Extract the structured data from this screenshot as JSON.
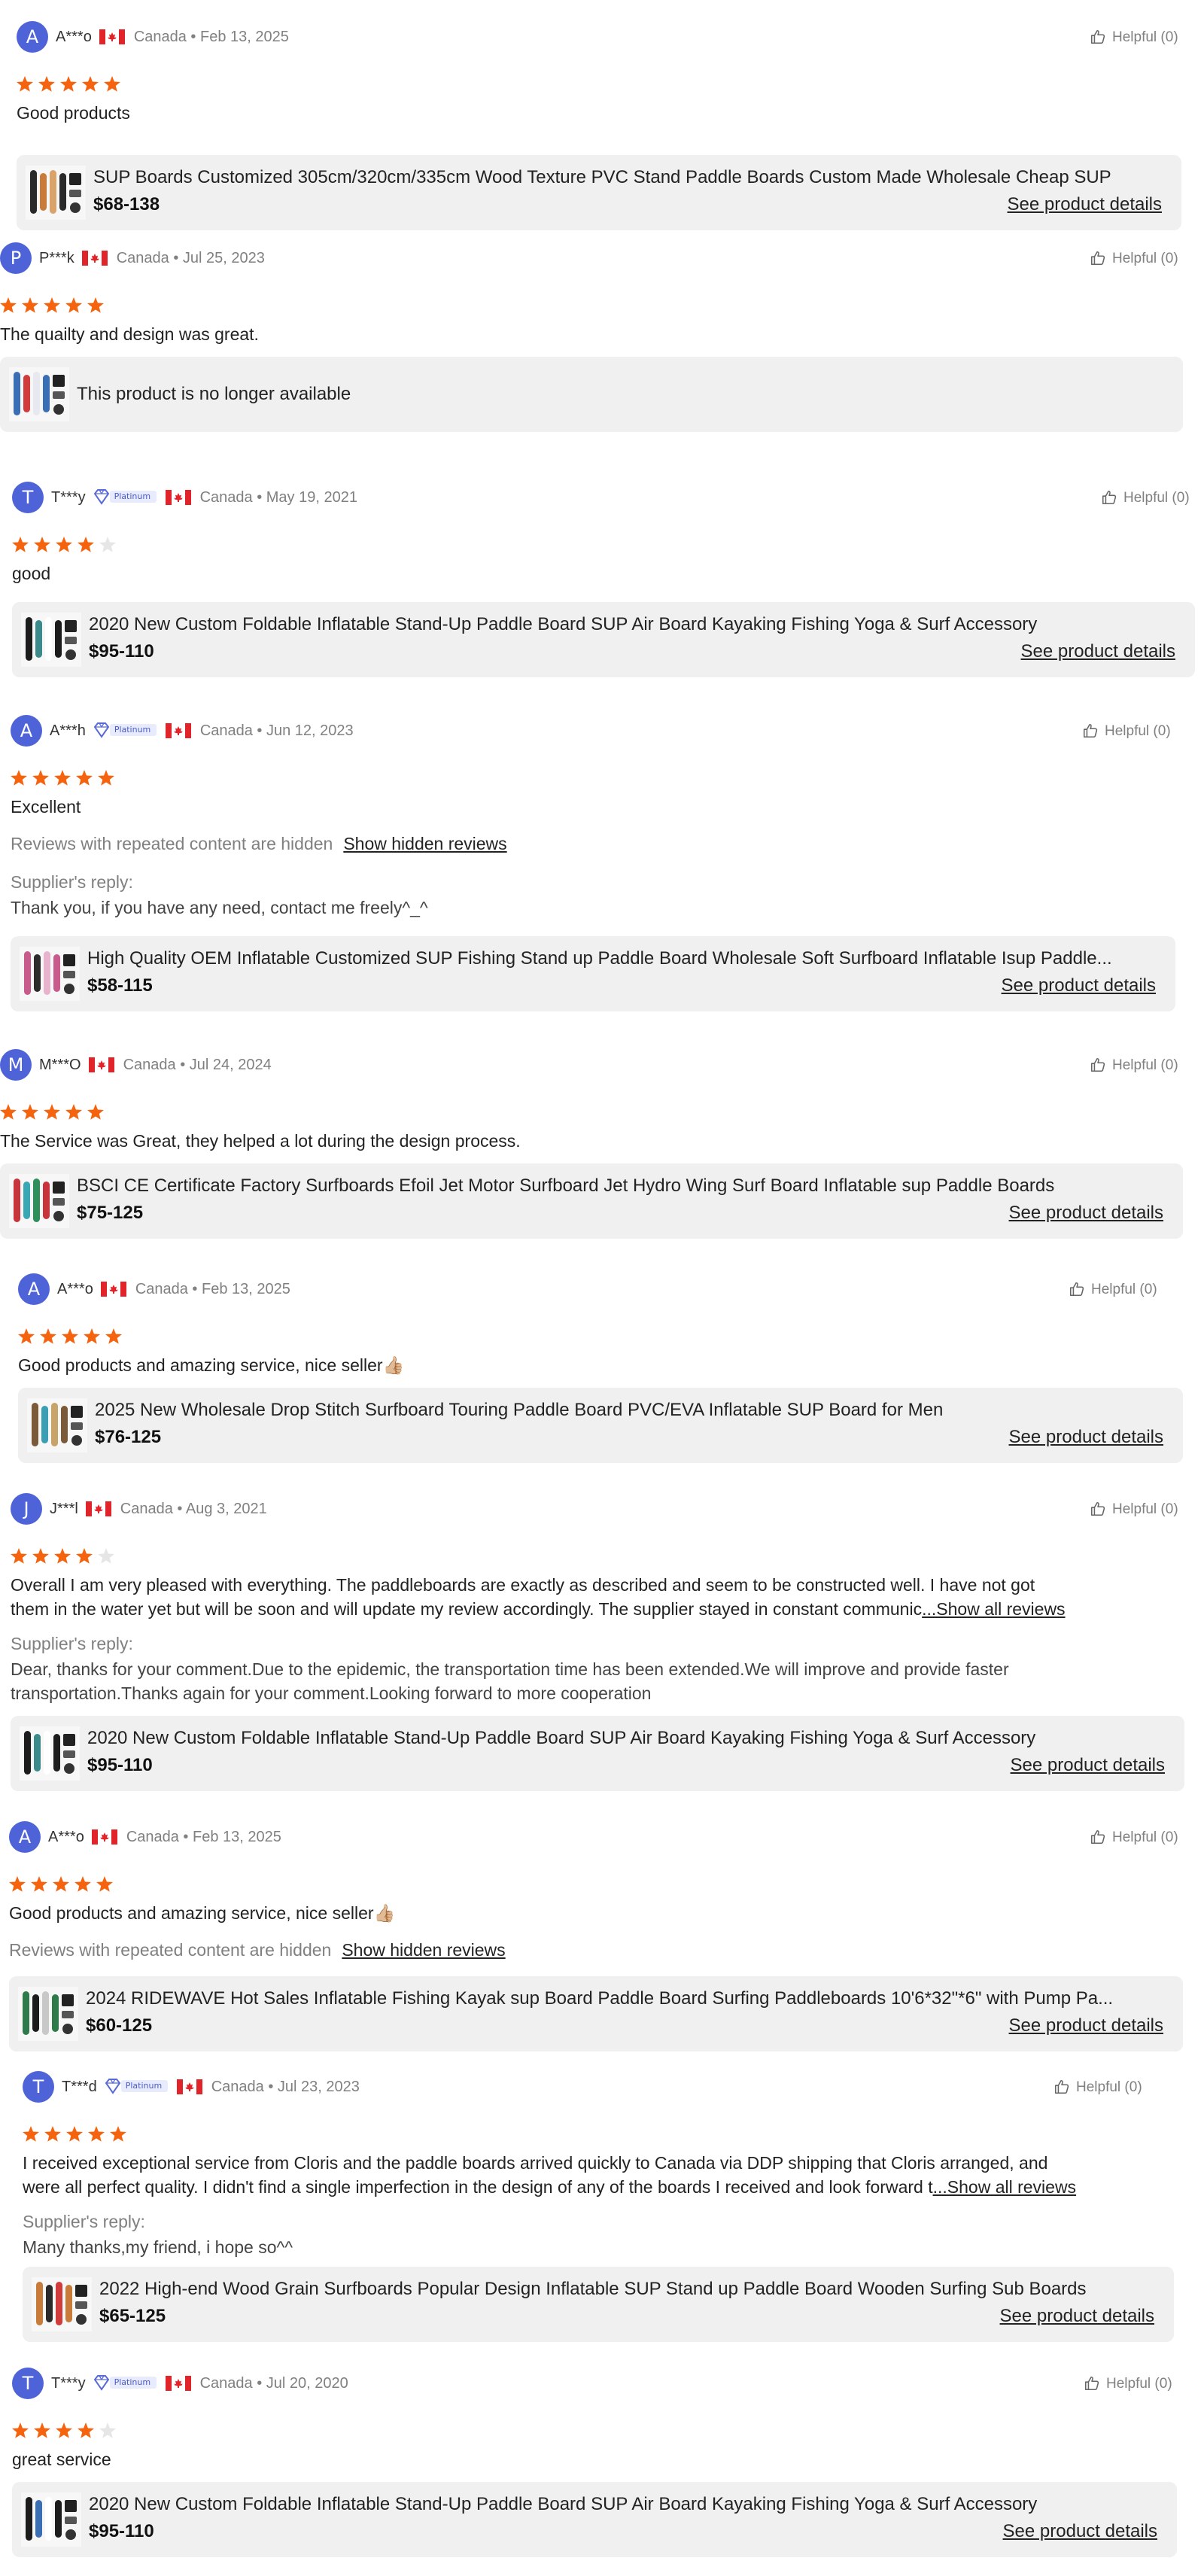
{
  "common": {
    "helpful": "Helpful (0)",
    "see_details": "See product details",
    "hidden_note": "Reviews with repeated content are hidden",
    "hidden_link": "Show hidden reviews",
    "supplier_reply_label": "Supplier's reply:",
    "show_all": "...Show all reviews",
    "platinum": "Platinum",
    "star_color": "#f5630f",
    "star_empty_color": "#e6e6e6",
    "avatar_color": "#4f63d8"
  },
  "reviews": [
    {
      "avatar": "A",
      "user": "A***o",
      "country": "Canada",
      "date": "Feb 13, 2025",
      "rating": 5,
      "text": "Good products",
      "product": {
        "title": "SUP Boards Customized 305cm/320cm/335cm Wood Texture PVC Stand Paddle Boards Custom Made Wholesale Cheap SUP",
        "price": "$68-138"
      }
    },
    {
      "avatar": "P",
      "user": "P***k",
      "country": "Canada",
      "date": "Jul 25, 2023",
      "rating": 5,
      "text": "The quailty and design was great.",
      "product": {
        "unavailable": "This product is no longer available"
      }
    },
    {
      "avatar": "T",
      "user": "T***y",
      "country": "Canada",
      "date": "May 19, 2021",
      "rating": 4,
      "text": "good",
      "product": {
        "title": "2020 New Custom Foldable Inflatable Stand-Up Paddle Board SUP Air Board Kayaking Fishing Yoga & Surf Accessory",
        "price": "$95-110"
      }
    },
    {
      "avatar": "A",
      "user": "A***h",
      "country": "Canada",
      "date": "Jun 12, 2023",
      "rating": 5,
      "text": "Excellent",
      "reply": "Thank you, if you have any need, contact me freely^_^",
      "product": {
        "title": "High Quality OEM Inflatable Customized SUP Fishing Stand up Paddle Board Wholesale Soft Surfboard Inflatable Isup Paddle...",
        "price": "$58-115"
      }
    },
    {
      "avatar": "M",
      "user": "M***O",
      "country": "Canada",
      "date": "Jul 24, 2024",
      "rating": 5,
      "text": "The Service was Great, they helped a lot during the design process.",
      "product": {
        "title": "BSCI CE Certificate Factory Surfboards Efoil Jet Motor Surfboard Jet Hydro Wing Surf Board Inflatable sup Paddle Boards",
        "price": "$75-125"
      }
    },
    {
      "avatar": "A",
      "user": "A***o",
      "country": "Canada",
      "date": "Feb 13, 2025",
      "rating": 5,
      "text": "Good products and amazing service, nice seller👍🏼",
      "product": {
        "title": "2025 New Wholesale Drop Stitch Surfboard Touring Paddle Board PVC/EVA Inflatable SUP Board for Men",
        "price": "$76-125"
      }
    },
    {
      "avatar": "J",
      "user": "J***l",
      "country": "Canada",
      "date": "Aug 3, 2021",
      "rating": 4,
      "text": "Overall I am very pleased with everything. The paddleboards are exactly as described and seem to be constructed well. I have not got",
      "text2": "them in the water yet but will be soon and will update my review accordingly. The supplier stayed in constant communic",
      "reply": "Dear, thanks for your comment.Due to the epidemic, the transportation time has been extended.We will improve and provide faster",
      "reply2": "transportation.Thanks again for your comment.Looking forward to more cooperation",
      "product": {
        "title": "2020 New Custom Foldable Inflatable Stand-Up Paddle Board SUP Air Board Kayaking Fishing Yoga & Surf Accessory",
        "price": "$95-110"
      }
    },
    {
      "avatar": "A",
      "user": "A***o",
      "country": "Canada",
      "date": "Feb 13, 2025",
      "rating": 5,
      "text": "Good products and amazing service, nice seller👍🏼",
      "product": {
        "title": "2024 RIDEWAVE Hot Sales Inflatable Fishing Kayak sup Board Paddle Board Surfing Paddleboards 10'6*32\"*6\" with Pump Pa...",
        "price": "$60-125"
      }
    },
    {
      "avatar": "T",
      "user": "T***d",
      "country": "Canada",
      "date": "Jul 23, 2023",
      "rating": 5,
      "text": "I received exceptional service from Cloris and the paddle boards arrived quickly to Canada via DDP shipping that Cloris arranged, and",
      "text2": "were all perfect quality. I didn't find a single imperfection in the design of any of the boards I received and look forward t",
      "reply": "Many thanks,my friend, i hope so^^",
      "product": {
        "title": "2022 High-end Wood Grain Surfboards Popular Design Inflatable SUP Stand up Paddle Board Wooden Surfing Sub Boards",
        "price": "$65-125"
      }
    },
    {
      "avatar": "T",
      "user": "T***y",
      "country": "Canada",
      "date": "Jul 20, 2020",
      "rating": 4,
      "text": "great service",
      "product": {
        "title": "2020 New Custom Foldable Inflatable Stand-Up Paddle Board SUP Air Board Kayaking Fishing Yoga & Surf Accessory",
        "price": "$95-110"
      }
    }
  ]
}
